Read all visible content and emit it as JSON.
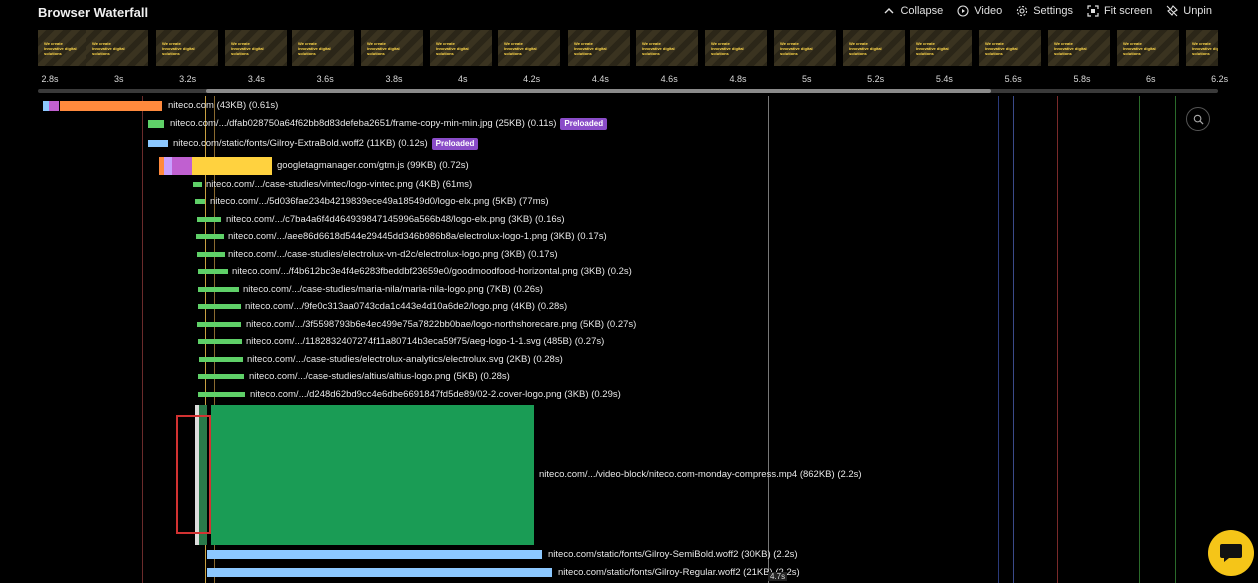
{
  "header": {
    "title": "Browser Waterfall",
    "tools": {
      "collapse": "Collapse",
      "video": "Video",
      "settings": "Settings",
      "fit": "Fit screen",
      "unpin": "Unpin"
    }
  },
  "filmstrip": {
    "frame_text": "We create\ninnovative digital\nsolutions",
    "frames": [
      {
        "state": "orange"
      },
      {
        "state": "orange"
      },
      {
        "state": "orange"
      },
      {
        "state": "green"
      },
      {
        "state": "green"
      },
      {
        "state": "green"
      },
      {
        "state": "green"
      },
      {
        "state": "green"
      },
      {
        "state": "green"
      },
      {
        "state": "green"
      },
      {
        "state": "green"
      },
      {
        "state": "green"
      },
      {
        "state": "green"
      },
      {
        "state": "green"
      },
      {
        "state": "green"
      },
      {
        "state": "green"
      },
      {
        "state": "green"
      },
      {
        "state": "green"
      }
    ]
  },
  "timeline": {
    "ticks": [
      "2.8s",
      "3s",
      "3.2s",
      "3.4s",
      "3.6s",
      "3.8s",
      "4s",
      "4.2s",
      "4.4s",
      "4.6s",
      "4.8s",
      "5s",
      "5.2s",
      "5.4s",
      "5.6s",
      "5.8s",
      "6s",
      "6.2s"
    ],
    "cursor_time": "4.7s"
  },
  "colors": {
    "html": "#ff8a3d",
    "image": "#5fd068",
    "font": "#8cc8ff",
    "script": "#ffd23f",
    "dns": "#c060d0",
    "video": "#1a9c55",
    "badge": "#8a4cc8",
    "accent": "#f5c518"
  },
  "requests": [
    {
      "label": "niteco.com (43KB) (0.61s)",
      "badge": ""
    },
    {
      "label": "niteco.com/.../dfab028750a64f62bb8d83defeba2651/frame-copy-min-min.jpg (25KB) (0.11s)",
      "badge": "Preloaded"
    },
    {
      "label": "niteco.com/static/fonts/Gilroy-ExtraBold.woff2 (11KB) (0.12s)",
      "badge": "Preloaded"
    },
    {
      "label": "googletagmanager.com/gtm.js (99KB) (0.72s)",
      "badge": ""
    },
    {
      "label": "niteco.com/.../case-studies/vintec/logo-vintec.png (4KB) (61ms)",
      "badge": ""
    },
    {
      "label": "niteco.com/.../5d036fae234b4219839ece49a18549d0/logo-elx.png (5KB) (77ms)",
      "badge": ""
    },
    {
      "label": "niteco.com/.../c7ba4a6f4d464939847145996a566b48/logo-elx.png (3KB) (0.16s)",
      "badge": ""
    },
    {
      "label": "niteco.com/.../aee86d6618d544e29445dd346b986b8a/electrolux-logo-1.png (3KB) (0.17s)",
      "badge": ""
    },
    {
      "label": "niteco.com/.../case-studies/electrolux-vn-d2c/electrolux-logo.png (3KB) (0.17s)",
      "badge": ""
    },
    {
      "label": "niteco.com/.../f4b612bc3e4f4e6283fbeddbf23659e0/goodmoodfood-horizontal.png (3KB) (0.2s)",
      "badge": ""
    },
    {
      "label": "niteco.com/.../case-studies/maria-nila/maria-nila-logo.png (7KB) (0.26s)",
      "badge": ""
    },
    {
      "label": "niteco.com/.../9fe0c313aa0743cda1c443e4d10a6de2/logo.png (4KB) (0.28s)",
      "badge": ""
    },
    {
      "label": "niteco.com/.../3f5598793b6e4ec499e75a7822bb0bae/logo-northshorecare.png (5KB) (0.27s)",
      "badge": ""
    },
    {
      "label": "niteco.com/.../1182832407274f11a80714b3eca59f75/aeg-logo-1-1.svg (485B) (0.27s)",
      "badge": ""
    },
    {
      "label": "niteco.com/.../case-studies/electrolux-analytics/electrolux.svg (2KB) (0.28s)",
      "badge": ""
    },
    {
      "label": "niteco.com/.../case-studies/altius/altius-logo.png (5KB) (0.28s)",
      "badge": ""
    },
    {
      "label": "niteco.com/.../d248d62bd9cc4e6dbe6691847fd5de89/02-2.cover-logo.png (3KB) (0.29s)",
      "badge": ""
    },
    {
      "label": "niteco.com/.../video-block/niteco.com-monday-compress.mp4 (862KB) (2.2s)",
      "badge": ""
    },
    {
      "label": "niteco.com/static/fonts/Gilroy-SemiBold.woff2 (30KB) (2.2s)",
      "badge": ""
    },
    {
      "label": "niteco.com/static/fonts/Gilroy-Regular.woff2 (21KB) (2.2s)",
      "badge": ""
    }
  ]
}
